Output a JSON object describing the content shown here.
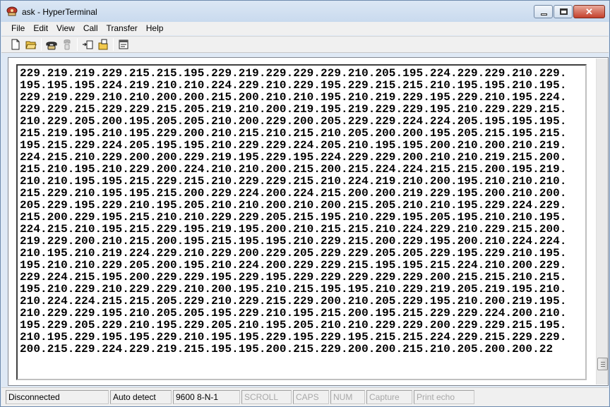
{
  "window": {
    "title": "ask - HyperTerminal"
  },
  "menu": [
    "File",
    "Edit",
    "View",
    "Call",
    "Transfer",
    "Help"
  ],
  "toolbar": {
    "buttons": [
      "new-document-icon",
      "open-folder-icon",
      "phone-call-icon",
      "hang-up-icon",
      "send-file-icon",
      "receive-file-icon",
      "properties-icon"
    ]
  },
  "terminal": {
    "lines": [
      "229.219.219.229.215.215.195.229.219.229.229.229.210.205.195.224.229.229.210.229.",
      "195.195.195.224.219.210.210.224.229.210.229.195.229.215.215.210.195.195.210.195.",
      "229.219.229.210.210.200.200.215.200.210.210.195.210.219.229.195.229.210.195.224.",
      "229.229.215.229.229.215.205.219.210.200.219.195.219.229.229.195.210.229.229.215.",
      "210.229.205.200.195.205.205.210.200.229.200.205.229.229.224.224.205.195.195.195.",
      "215.219.195.210.195.229.200.210.215.210.215.210.205.200.200.195.205.215.195.215.",
      "195.215.229.224.205.195.195.210.229.229.224.205.210.195.195.200.210.200.210.219.",
      "224.215.210.229.200.200.229.219.195.229.195.224.229.229.200.210.210.219.215.200.",
      "215.210.195.210.229.200.224.210.210.200.215.200.215.224.224.215.215.200.195.219.",
      "210.210.195.195.215.229.215.210.229.229.215.210.224.219.210.200.195.210.210.210.",
      "215.229.210.195.195.215.200.229.224.200.224.215.200.200.219.229.195.200.210.200.",
      "205.229.195.229.210.195.205.210.210.200.210.200.215.205.210.210.195.229.224.229.",
      "215.200.229.195.215.210.210.229.229.205.215.195.210.229.195.205.195.210.210.195.",
      "224.215.210.195.215.229.195.219.195.200.210.215.215.210.224.229.210.229.215.200.",
      "219.229.200.210.215.200.195.215.195.195.210.229.215.200.229.195.200.210.224.224.",
      "210.195.210.219.224.229.210.229.200.229.205.229.229.205.205.229.195.229.210.195.",
      "195.210.210.229.205.200.195.210.224.200.229.229.215.195.195.215.224.210.200.229.",
      "229.224.215.195.200.229.229.195.229.195.229.229.229.229.229.200.215.215.210.215.",
      "195.210.229.210.229.229.210.200.195.210.215.195.195.210.229.219.205.219.195.210.",
      "210.224.224.215.215.205.229.210.229.215.229.200.210.205.229.195.210.200.219.195.",
      "210.229.229.195.210.205.205.195.229.210.195.215.200.195.215.229.229.224.200.210.",
      "195.229.205.229.210.195.229.205.210.195.205.210.210.229.229.200.229.229.215.195.",
      "210.195.229.195.195.229.210.195.195.229.195.229.195.215.215.224.229.215.229.229.",
      "200.215.229.224.229.219.215.195.195.200.215.229.200.200.215.210.205.200.200.22"
    ]
  },
  "status": {
    "connection": "Disconnected",
    "detect": "Auto detect",
    "settings": "9600 8-N-1",
    "scroll": "SCROLL",
    "caps": "CAPS",
    "num": "NUM",
    "capture": "Capture",
    "print_echo": "Print echo"
  }
}
